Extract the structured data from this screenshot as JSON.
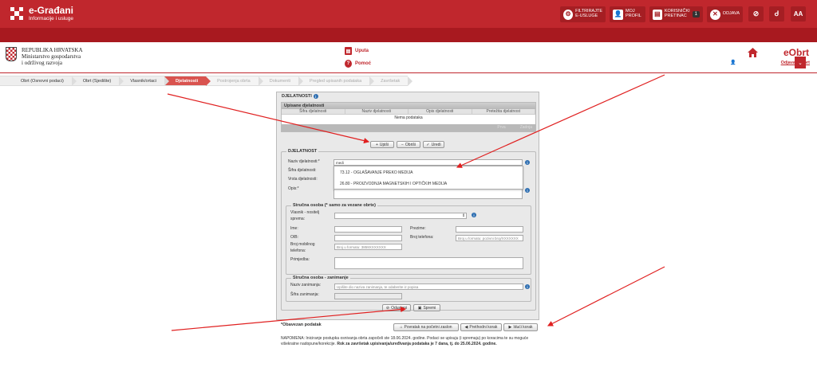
{
  "header": {
    "title": "e-Građani",
    "subtitle": "Informacije i usluge",
    "buttons": [
      {
        "icon": "filter-icon",
        "label_1": "FILTRIRAJTE",
        "label_2": "E-USLUGE"
      },
      {
        "icon": "profile-icon",
        "label_1": "MOJ",
        "label_2": "PROFIL"
      },
      {
        "icon": "inbox-icon",
        "label_1": "KORISNIČKI",
        "label_2": "PRETINAC",
        "badge": "1"
      },
      {
        "icon": "logout-icon",
        "label_1": "ODJAVA"
      }
    ],
    "user": "IVAN LOVRE MARUŠIĆ",
    "contrast_glyph": "Ꮷ",
    "font_size_glyph": "AA"
  },
  "ministry": {
    "line1": "REPUBLIKA HRVATSKA",
    "line2": "Ministarstvo gospodarstva",
    "line3": "i održivog razvoja"
  },
  "help": {
    "uputa": "Uputa",
    "pomoc": "Pomoć"
  },
  "eobrt": {
    "title": "eObrt",
    "logout": "Odjava e-Obrt"
  },
  "steps": [
    {
      "label": "Obrt (Osnovni podaci)",
      "state": "done"
    },
    {
      "label": "Obrt (Sjedište)",
      "state": "done"
    },
    {
      "label": "Vlasnik/ortaci",
      "state": "done"
    },
    {
      "label": "Djelatnosti",
      "state": "active"
    },
    {
      "label": "Postrojenja obrta",
      "state": "disabled"
    },
    {
      "label": "Dokumenti",
      "state": "disabled"
    },
    {
      "label": "Pregled upisanih podataka",
      "state": "disabled"
    },
    {
      "label": "Završetak",
      "state": "disabled"
    }
  ],
  "djelatnosti": {
    "section_title": "DJELATNOSTI",
    "grid_title": "Upisane djelatnosti",
    "columns": [
      "Šifra djelatnosti",
      "Naziv djelatnosti",
      "Opis djelatnosti",
      "Pretežita djelatnost"
    ],
    "empty": "Nema podataka",
    "prev": "Prva",
    "next": "Zadnja",
    "btn_add": "Upiši",
    "btn_delete": "Obriši",
    "btn_edit": "Uredi"
  },
  "djelatnost_form": {
    "legend": "DJELATNOST",
    "naziv_label": "Naziv djelatnosti:*",
    "naziv_value": "medi",
    "sifra_label": "Šifra djelatnosti:",
    "vrsta_label": "Vrsta djelatnosti:",
    "opis_label": "Opis:*",
    "dropdown": [
      "73.12 - OGLAŠAVANJE PREKO MEDIJA",
      "26.80 - PROIZVODNJA MAGNETSKIH I OPTIČKIH MEDIJA"
    ]
  },
  "strucna_osoba": {
    "legend": "Stručna osoba (* samo za vezane obrte)",
    "vlasnik_label_1": "Vlasnik - nositelj",
    "vlasnik_label_2": "sprema:",
    "ime_label": "Ime:",
    "prezime_label": "Prezime:",
    "oib_label": "OIB:",
    "tel_label": "Broj telefona:",
    "tel_placeholder": "Broj u formatu: pozivni broj/XXXXXXX",
    "mob_label_1": "Broj mobilnog",
    "mob_label_2": "telefona:",
    "mob_placeholder": "Broj u formatu: 3859XXXXXXX",
    "primjedba_label": "Primjedba:"
  },
  "zanimanje": {
    "legend": "Stručna osoba - zanimanje",
    "naziv_label": "Naziv zanimanja:",
    "naziv_placeholder": "Upišite dio naziva zanimanja, te odaberite iz popisa",
    "sifra_label": "Šifra zanimanja:"
  },
  "form_buttons": {
    "cancel": "Odustani",
    "save": "Spremi"
  },
  "nav_buttons": {
    "start": "Povratak na početni zaslon",
    "prev": "Prethodni korak",
    "next": "Idući korak"
  },
  "required_note": "*Obavezan podatak",
  "note": {
    "text": "NAPOMENA: Iniciranje postupka osnivanja obrta započeli ste 18.06.2024. godine. Podaci se upisuju (i spremaju) po koracima te su moguće višekratne nadopune/korekcije. ",
    "bold": "Rok za završetak upisivanja/uređivanja podataka je 7 dana, tj. do 25.06.2024. godine."
  },
  "colors": {
    "brand": "#c0272d",
    "brand_dark": "#a8191f",
    "active_step": "#d9534f",
    "annotation": "#e02020"
  }
}
